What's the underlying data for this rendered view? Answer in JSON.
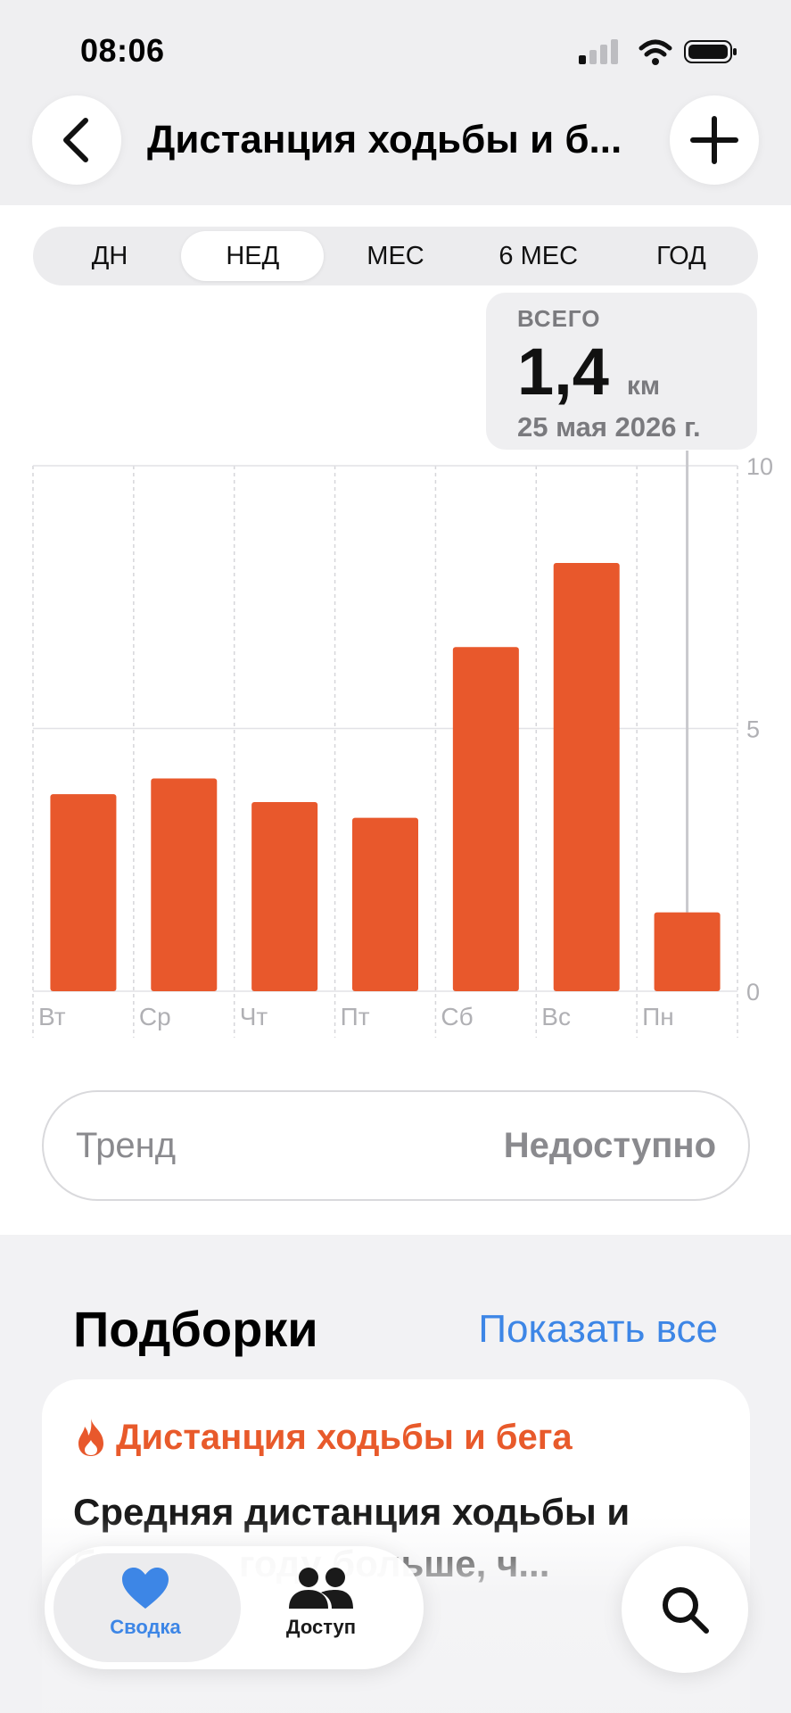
{
  "status_bar": {
    "time": "08:06"
  },
  "header": {
    "title": "Дистанция ходьбы и б..."
  },
  "segmented": {
    "items": [
      "ДН",
      "НЕД",
      "МЕС",
      "6 МЕС",
      "ГОД"
    ],
    "selected": "НЕД"
  },
  "callout": {
    "label": "ВСЕГО",
    "value": "1,4",
    "unit": "км",
    "date": "25 мая 2026 г."
  },
  "chart_data": {
    "type": "bar",
    "categories": [
      "Вт",
      "Ср",
      "Чт",
      "Пт",
      "Сб",
      "Вс",
      "Пн"
    ],
    "values": [
      3.75,
      4.05,
      3.6,
      3.3,
      6.55,
      8.15,
      1.5
    ],
    "y_ticks": [
      "10",
      "5",
      "0"
    ],
    "ylim": [
      0,
      10
    ],
    "highlighted": "Пн",
    "bar_color": "#e8582c"
  },
  "trend": {
    "label": "Тренд",
    "value": "Недоступно"
  },
  "highlights": {
    "title": "Подборки",
    "show_all": "Показать все",
    "card_category": "Дистанция ходьбы и бега",
    "card_text": "Средняя дистанция ходьбы и бега в ... году больше, ч..."
  },
  "tabbar": {
    "summary": "Сводка",
    "sharing": "Доступ"
  },
  "colors": {
    "accent": "#3d86e6",
    "orange": "#e8582c"
  }
}
